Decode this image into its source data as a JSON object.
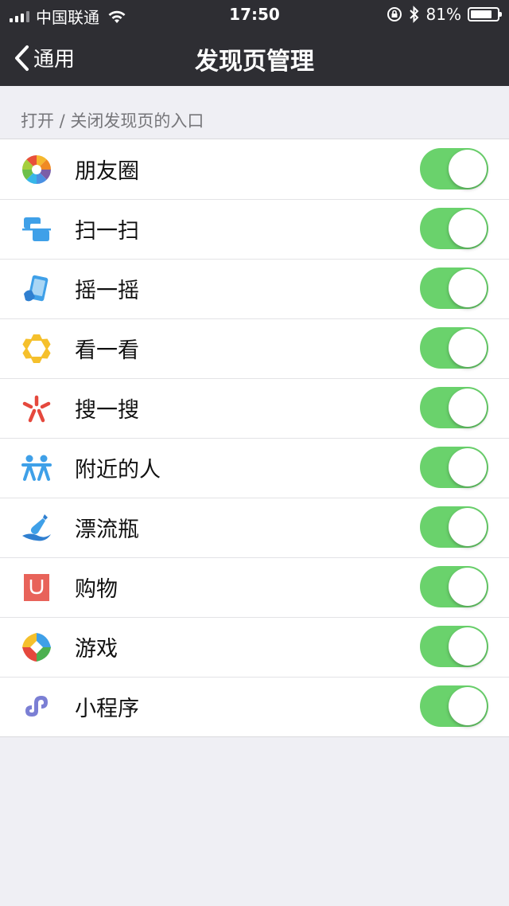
{
  "status_bar": {
    "carrier": "中国联通",
    "time": "17:50",
    "battery_percent": "81%",
    "battery_level": 0.81
  },
  "nav": {
    "back_label": "通用",
    "title": "发现页管理"
  },
  "section": {
    "header": "打开 / 关闭发现页的入口"
  },
  "items": [
    {
      "label": "朋友圈",
      "icon": "moments-icon",
      "enabled": true
    },
    {
      "label": "扫一扫",
      "icon": "scan-icon",
      "enabled": true
    },
    {
      "label": "摇一摇",
      "icon": "shake-icon",
      "enabled": true
    },
    {
      "label": "看一看",
      "icon": "top-stories-icon",
      "enabled": true
    },
    {
      "label": "搜一搜",
      "icon": "search-icon",
      "enabled": true
    },
    {
      "label": "附近的人",
      "icon": "people-nearby-icon",
      "enabled": true
    },
    {
      "label": "漂流瓶",
      "icon": "drift-bottle-icon",
      "enabled": true
    },
    {
      "label": "购物",
      "icon": "shopping-icon",
      "enabled": true
    },
    {
      "label": "游戏",
      "icon": "games-icon",
      "enabled": true
    },
    {
      "label": "小程序",
      "icon": "mini-programs-icon",
      "enabled": true
    }
  ],
  "colors": {
    "toggle_on": "#6ad26c",
    "nav_bg": "#2e2e33",
    "page_bg": "#efeff4"
  }
}
